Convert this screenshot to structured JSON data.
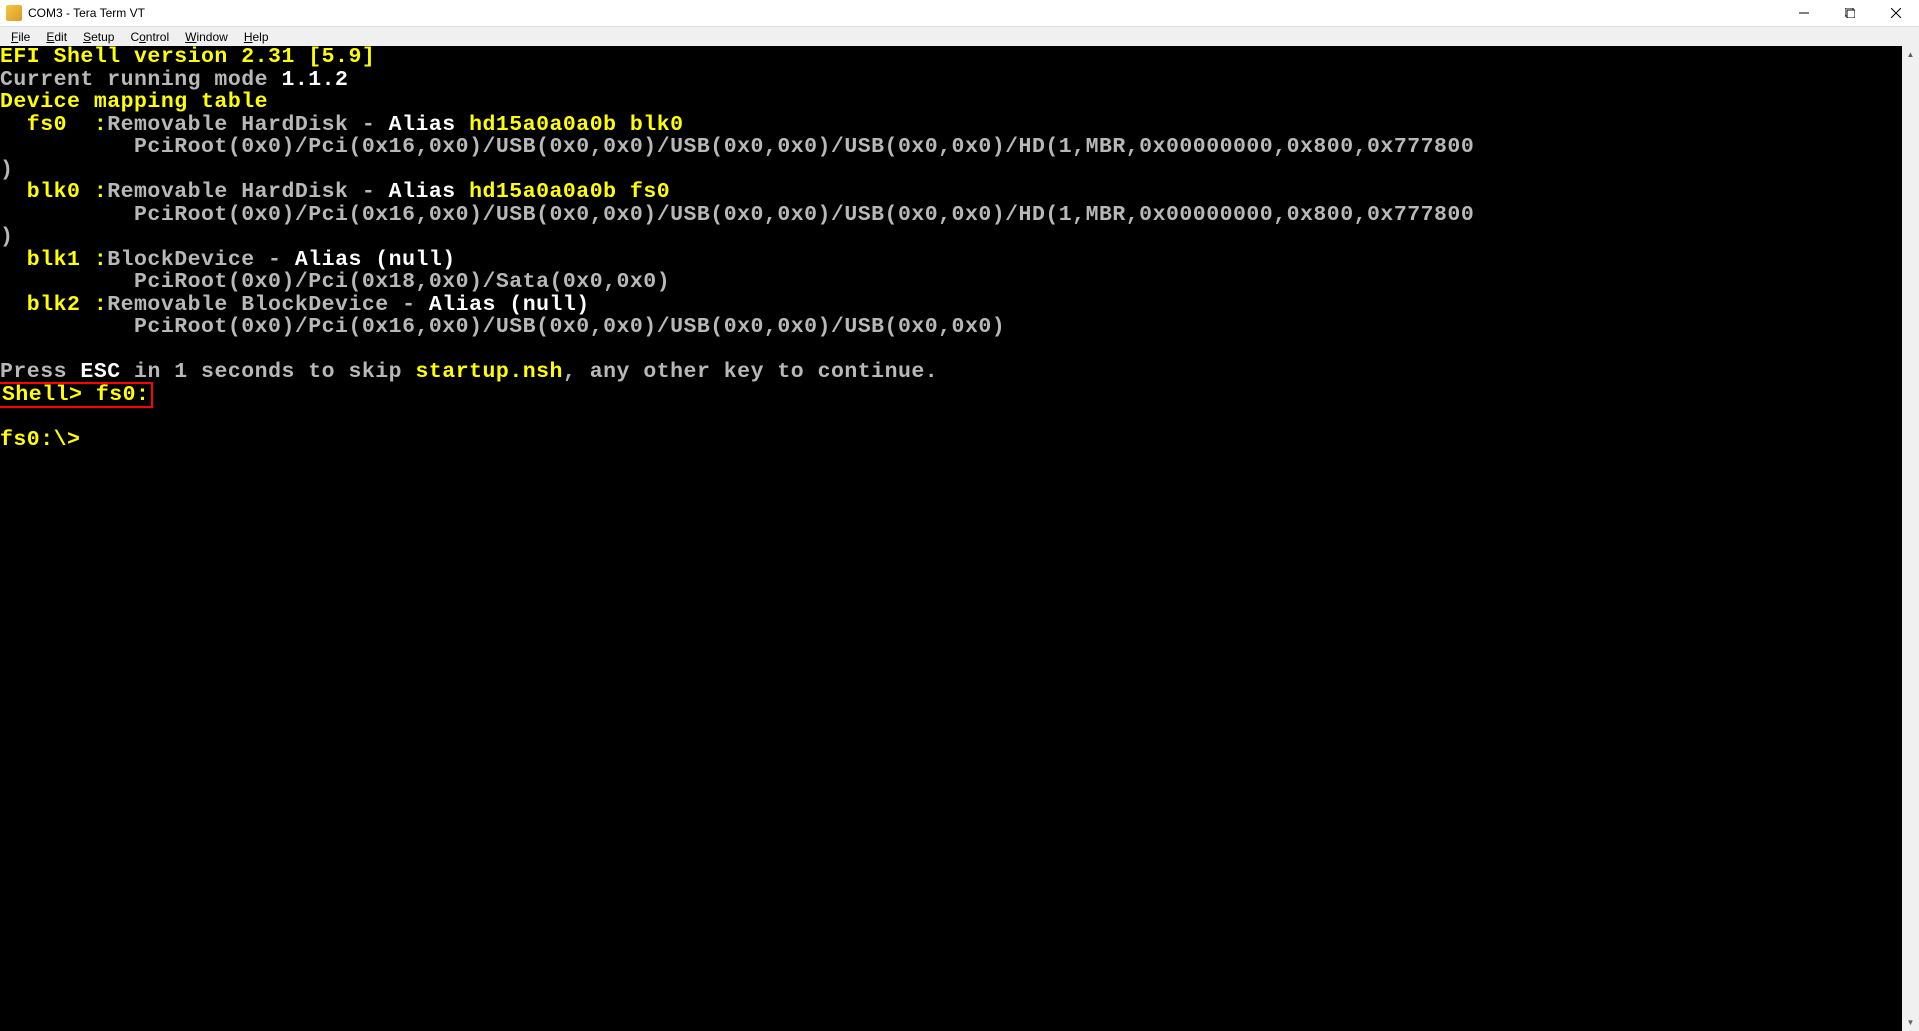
{
  "window": {
    "title": "COM3 - Tera Term VT"
  },
  "menu": {
    "file": "File",
    "edit": "Edit",
    "setup": "Setup",
    "control": "Control",
    "window": "Window",
    "help": "Help"
  },
  "t": {
    "efi_version_label": "EFI Shell version 2.31 [5.9]",
    "mode_label": "Current running mode ",
    "mode_value": "1.1.2",
    "mapping_header": "Device mapping table",
    "fs0_name": "  fs0  :",
    "fs0_desc": "Removable HardDisk - ",
    "alias_word": "Alias ",
    "fs0_alias": "hd15a0a0a0b blk0",
    "fs0_path": "          PciRoot(0x0)/Pci(0x16,0x0)/USB(0x0,0x0)/USB(0x0,0x0)/USB(0x0,0x0)/HD(1,MBR,0x00000000,0x800,0x777800",
    "paren_close": ")",
    "blk0_name": "  blk0 :",
    "blk0_desc": "Removable HardDisk - ",
    "blk0_alias": "hd15a0a0a0b fs0",
    "blk0_path": "          PciRoot(0x0)/Pci(0x16,0x0)/USB(0x0,0x0)/USB(0x0,0x0)/USB(0x0,0x0)/HD(1,MBR,0x00000000,0x800,0x777800",
    "blk1_name": "  blk1 :",
    "blk1_desc": "BlockDevice - ",
    "null_alias": "(null)",
    "blk1_path": "          PciRoot(0x0)/Pci(0x18,0x0)/Sata(0x0,0x0)",
    "blk2_name": "  blk2 :",
    "blk2_desc": "Removable BlockDevice - ",
    "blk2_path": "          PciRoot(0x0)/Pci(0x16,0x0)/USB(0x0,0x0)/USB(0x0,0x0)/USB(0x0,0x0)",
    "press1": "Press ",
    "esc": "ESC",
    "press2": " in 1 seconds to skip ",
    "startup": "startup.nsh",
    "press3": ", any other key to continue.",
    "shell_prompt": "Shell> fs0:",
    "fs0_prompt": "fs0:\\>"
  }
}
